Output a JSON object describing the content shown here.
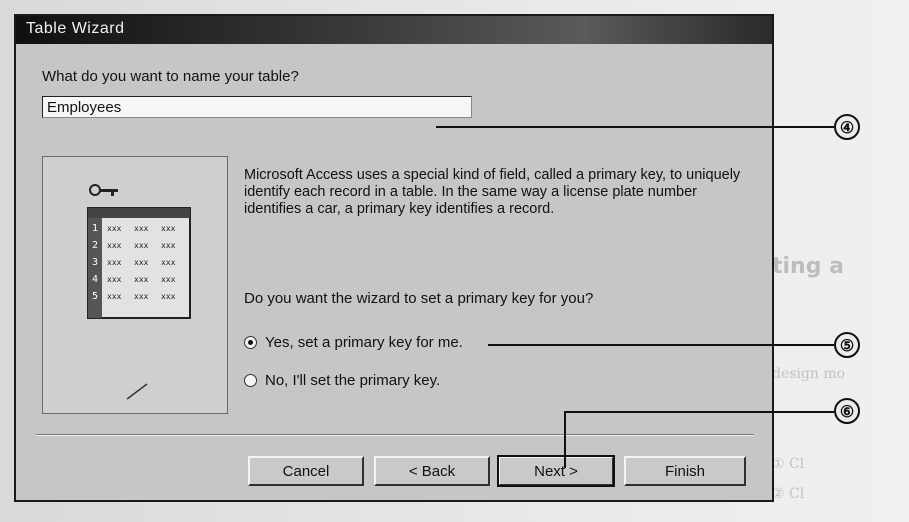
{
  "window": {
    "title": "Table Wizard"
  },
  "name_prompt": "What do you want to name your table?",
  "table_name": {
    "value": "Employees"
  },
  "description": "Microsoft Access uses a special kind of field, called a primary key, to uniquely identify each record in a table. In the same way a license plate number identifies a car, a primary key identifies a record.",
  "primary_key_prompt": "Do you want the wizard to set a primary key for you?",
  "options": [
    {
      "label": "Yes, set a primary key for me.",
      "selected": true
    },
    {
      "label": "No, I'll set the primary key.",
      "selected": false
    }
  ],
  "illustration": {
    "row_numbers": [
      "1",
      "2",
      "3",
      "4",
      "5"
    ],
    "cell_text": "xxx"
  },
  "buttons": {
    "cancel": "Cancel",
    "back": "< Back",
    "next": "Next >",
    "finish": "Finish"
  },
  "callouts": [
    "④",
    "⑤",
    "⑥"
  ],
  "background_text": {
    "heading": "ting a",
    "lines": [
      "design mo",
      "①  Cl",
      "②  Cl"
    ]
  }
}
